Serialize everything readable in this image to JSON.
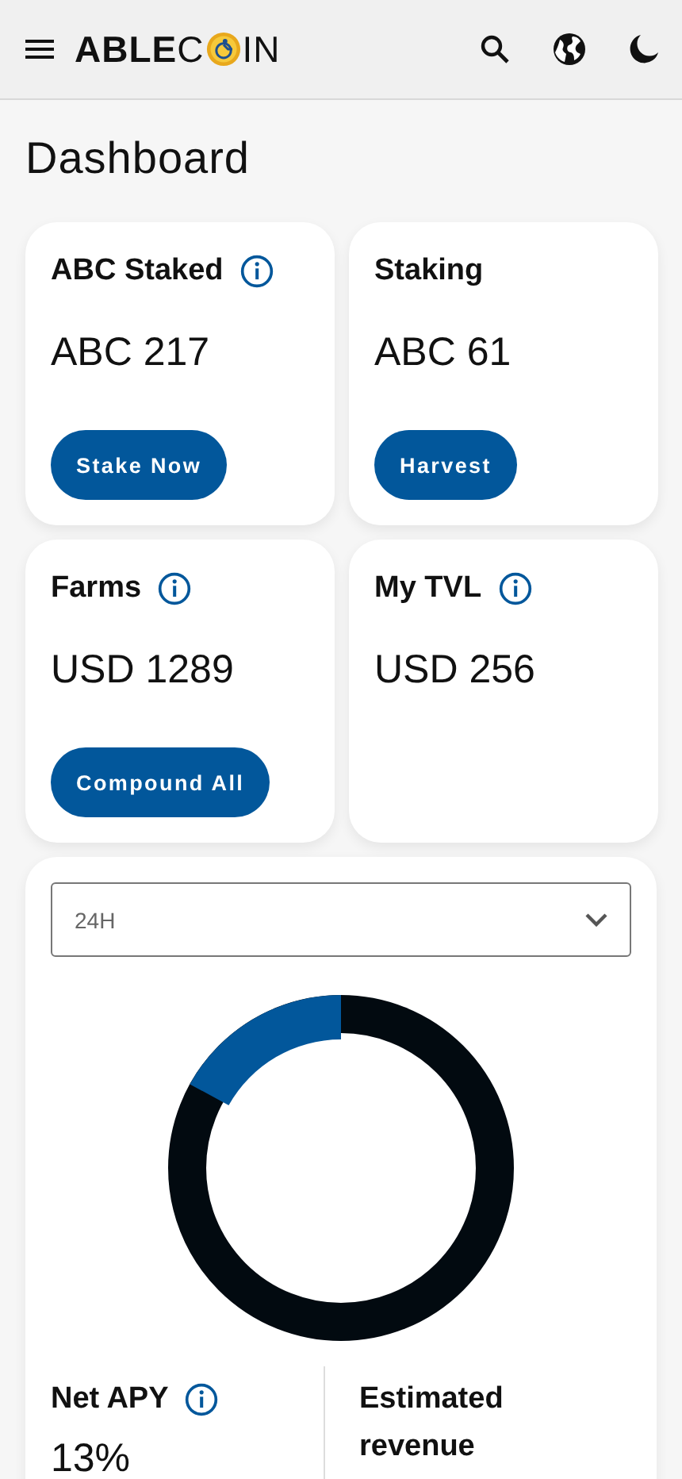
{
  "header": {
    "logo_start": "**ABLE**C",
    "logo_end": "IN"
  },
  "page_title": "Dashboard",
  "cards": [
    {
      "title": "ABC Staked",
      "info": true,
      "value": "ABC 217",
      "button": "Stake Now"
    },
    {
      "title": "Staking",
      "info": false,
      "value": "ABC 61",
      "button": "Harvest"
    },
    {
      "title": "Farms",
      "info": true,
      "value": "USD 1289",
      "button": "Compound All"
    },
    {
      "title": "My TVL",
      "info": true,
      "value": "USD 256"
    }
  ],
  "overview": {
    "period_select": {
      "value": "24H"
    },
    "stats": [
      {
        "title": "Net APY",
        "info": true,
        "value": "13%"
      },
      {
        "title": "Estimated revenue",
        "info": false
      }
    ]
  }
}
